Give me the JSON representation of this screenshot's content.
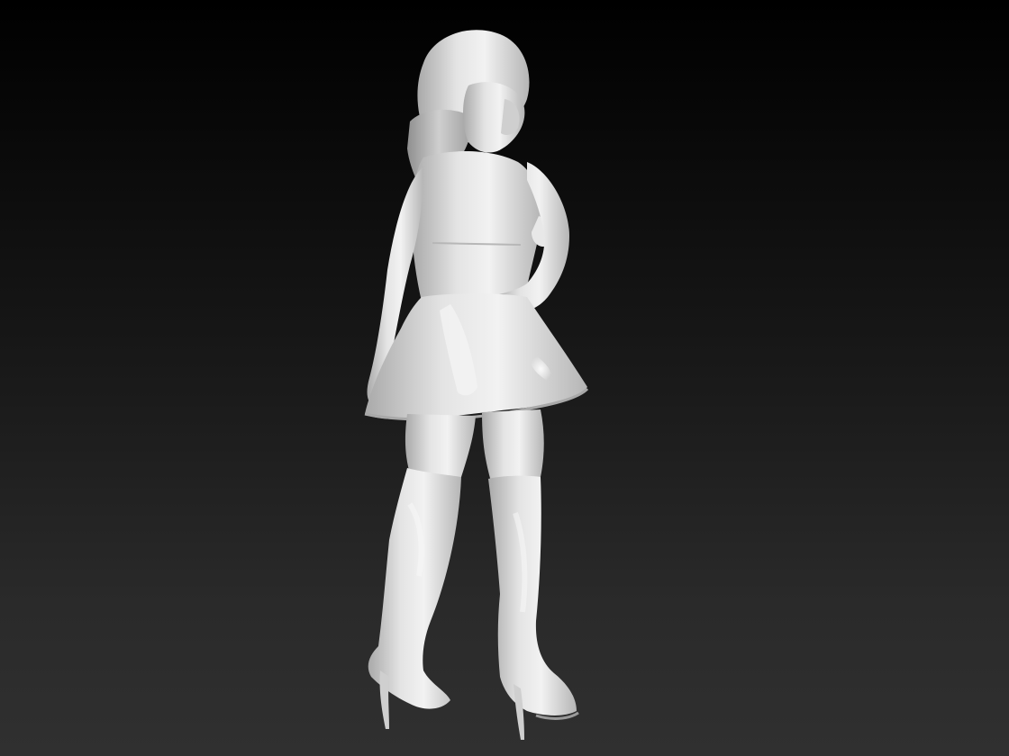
{
  "scene": {
    "background_top": "#000000",
    "background_bottom": "#303030",
    "model_base": "#dcdcdc",
    "model_highlight": "#f7f7f7",
    "model_shadow": "#8c8c8c",
    "subject": "sculpt-figure"
  }
}
